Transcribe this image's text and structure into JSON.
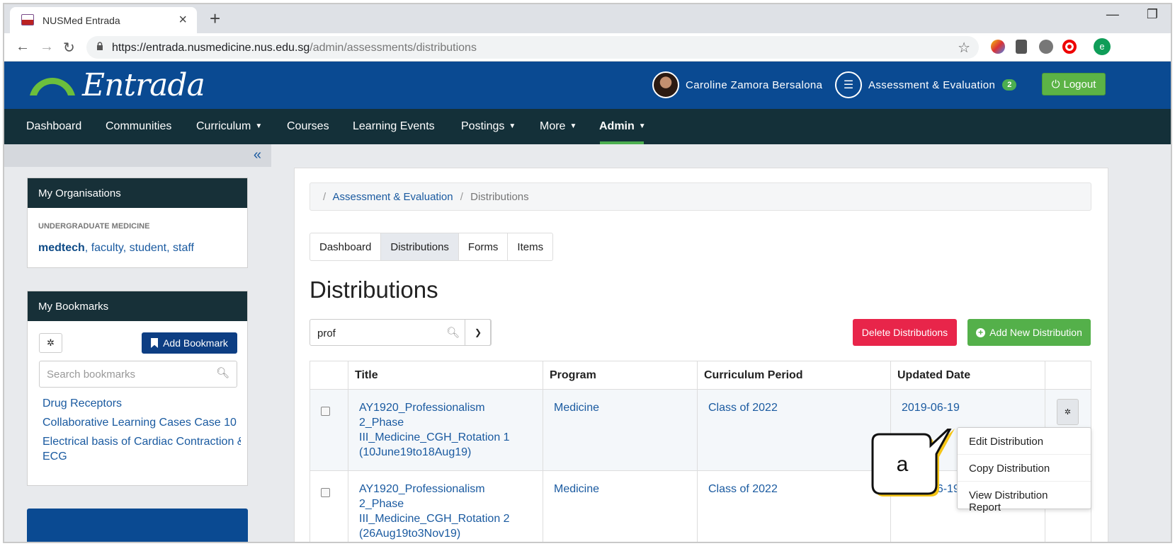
{
  "browser": {
    "tab_title": "NUSMed Entrada",
    "url_host": "https://entrada.nusmedicine.nus.edu.sg",
    "url_path": "/admin/assessments/distributions",
    "profile_initial": "e"
  },
  "header": {
    "logo_text": "Entrada",
    "user_name": "Caroline Zamora Bersalona",
    "assessment_label": "Assessment & Evaluation",
    "assessment_badge": "2",
    "logout_label": "Logout"
  },
  "nav": {
    "items": [
      "Dashboard",
      "Communities",
      "Curriculum",
      "Courses",
      "Learning Events",
      "Postings",
      "More",
      "Admin"
    ]
  },
  "sidebar": {
    "organisations": {
      "title": "My Organisations",
      "label": "UNDERGRADUATE MEDICINE",
      "links": [
        "medtech",
        "faculty",
        "student",
        "staff"
      ]
    },
    "bookmarks": {
      "title": "My Bookmarks",
      "add_label": "Add Bookmark",
      "search_placeholder": "Search bookmarks",
      "items": [
        "Drug Receptors",
        "Collaborative Learning Cases Case 10",
        "Electrical basis of Cardiac Contraction &",
        "ECG"
      ]
    }
  },
  "main": {
    "breadcrumb": [
      "Assessment & Evaluation",
      "Distributions"
    ],
    "tabs": [
      "Dashboard",
      "Distributions",
      "Forms",
      "Items"
    ],
    "page_title": "Distributions",
    "search_value": "prof",
    "delete_label": "Delete Distributions",
    "add_label": "Add New Distribution",
    "table": {
      "headers": [
        "Title",
        "Program",
        "Curriculum Period",
        "Updated Date"
      ],
      "rows": [
        {
          "title": [
            "AY1920_Professionalism 2_Phase",
            "III_Medicine_CGH_Rotation 1",
            "(10June19to18Aug19)"
          ],
          "program": "Medicine",
          "period": "Class of 2022",
          "date": "2019-06-19"
        },
        {
          "title": [
            "AY1920_Professionalism 2_Phase",
            "III_Medicine_CGH_Rotation 2",
            "(26Aug19to3Nov19)"
          ],
          "program": "Medicine",
          "period": "Class of 2022",
          "date": "2019-06-19"
        }
      ]
    },
    "menu": [
      "Edit Distribution",
      "Copy Distribution",
      "View Distribution Report"
    ]
  },
  "callout": {
    "label": "a"
  }
}
